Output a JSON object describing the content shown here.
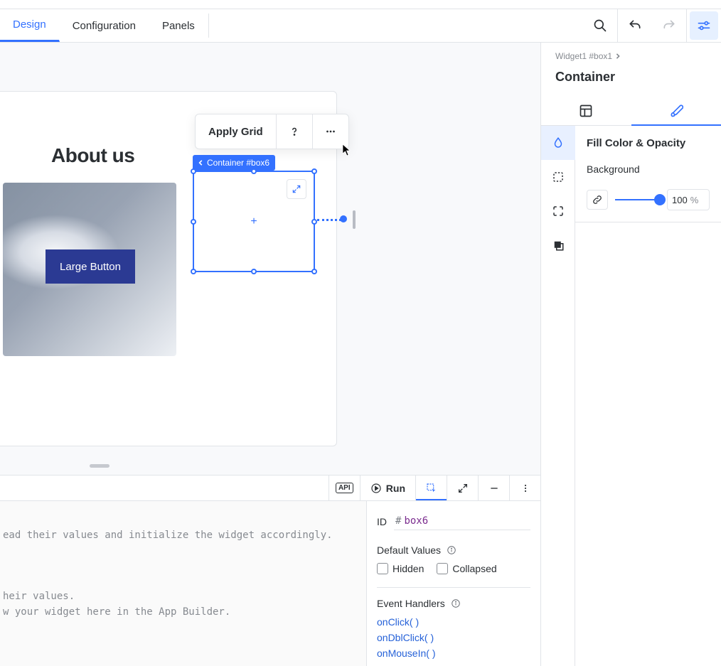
{
  "topbar": {
    "tabs": [
      "Design",
      "Configuration",
      "Panels"
    ],
    "active_tab": 0
  },
  "inspector": {
    "breadcrumb": "Widget1 #box1",
    "title": "Container",
    "style_section_title": "Fill Color & Opacity",
    "background_label": "Background",
    "opacity_value": "100",
    "opacity_unit": "%"
  },
  "canvas": {
    "page_heading": "About us",
    "large_button_label": "Large Button",
    "selection_tag": "Container #box6",
    "float_toolbar": {
      "apply_grid": "Apply Grid"
    }
  },
  "bottom": {
    "run_label": "Run",
    "code_lines": [
      "",
      "ead their values and initialize the widget accordingly.",
      "",
      "",
      "",
      "heir values.",
      "w your widget here in the App Builder."
    ],
    "props": {
      "id_label": "ID",
      "id_hash": "#",
      "id_value": "box6",
      "defaults_label": "Default Values",
      "hidden_label": "Hidden",
      "collapsed_label": "Collapsed",
      "handlers_label": "Event Handlers",
      "handlers": [
        "onClick( )",
        "onDblClick( )",
        "onMouseIn( )"
      ]
    }
  }
}
